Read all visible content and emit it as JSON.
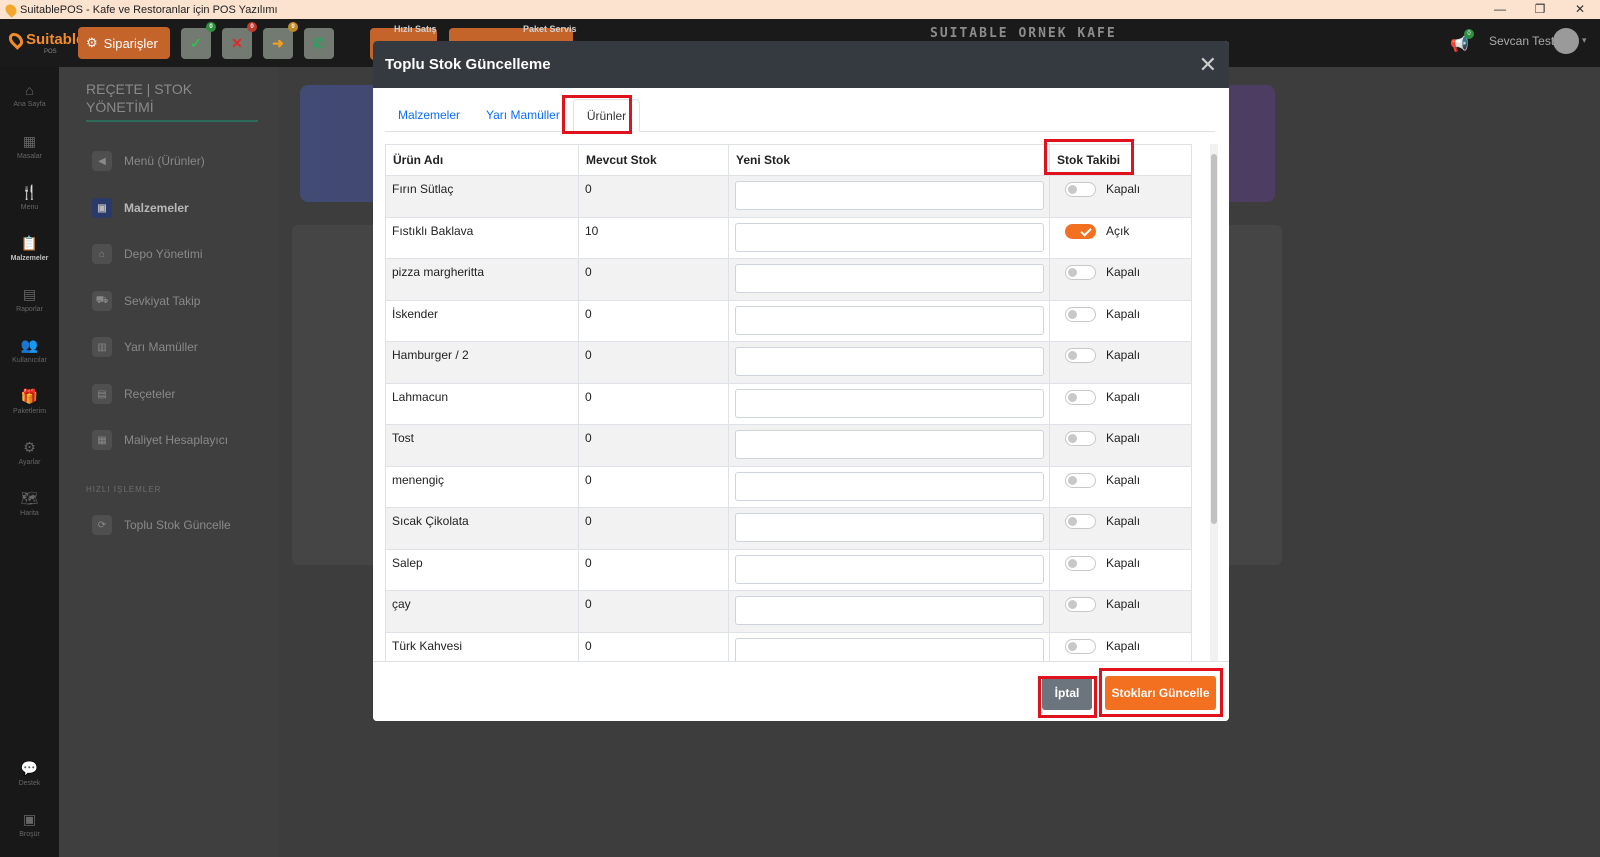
{
  "window": {
    "title": "SuitablePOS - Kafe ve Restoranlar için POS Yazılımı",
    "controls": [
      "—",
      "❐",
      "✕"
    ]
  },
  "header": {
    "logo": "Suitable",
    "logo_sub": "POS",
    "orders_label": "Siparişler",
    "badges": {
      "approved": "0",
      "rejected": "0",
      "forwarded": "0"
    },
    "quick_sale_label": "Hızlı Satış",
    "package_service_label": "Paket Servis",
    "cafe_name": "SUITABLE ORNEK KAFE",
    "notification_count": "0",
    "user_name": "Sevcan Test"
  },
  "sidebar": {
    "items": [
      {
        "label": "Ana Sayfa",
        "icon": "home-icon"
      },
      {
        "label": "Masalar",
        "icon": "table-icon"
      },
      {
        "label": "Menu",
        "icon": "utensils-icon"
      },
      {
        "label": "Malzemeler",
        "icon": "clipboard-icon"
      },
      {
        "label": "Raporlar",
        "icon": "report-icon"
      },
      {
        "label": "Kullanıcılar",
        "icon": "users-icon"
      },
      {
        "label": "Paketlerim",
        "icon": "gift-icon"
      },
      {
        "label": "Ayarlar",
        "icon": "gear-icon"
      },
      {
        "label": "Harita",
        "icon": "map-icon"
      },
      {
        "label": "Destek",
        "icon": "chat-icon"
      },
      {
        "label": "Broşür",
        "icon": "brochure-icon"
      }
    ]
  },
  "left_panel": {
    "title_line1": "REÇETE | STOK",
    "title_line2": "YÖNETİMİ",
    "menu": [
      "Menü (Ürünler)",
      "Malzemeler",
      "Depo Yönetimi",
      "Sevkiyat Takip",
      "Yarı Mamüller",
      "Reçeteler",
      "Maliyet Hesaplayıcı"
    ],
    "quick_section": "HIZLI İŞLEMLER",
    "quick_action": "Toplu Stok Güncelle"
  },
  "modal": {
    "title": "Toplu Stok Güncelleme",
    "close": "✕",
    "tabs": [
      "Malzemeler",
      "Yarı Mamüller",
      "Ürünler"
    ],
    "active_tab": "Ürünler",
    "columns": [
      "Ürün Adı",
      "Mevcut Stok",
      "Yeni Stok",
      "Stok Takibi"
    ],
    "rows": [
      {
        "name": "Fırın Sütlaç",
        "stock": "0",
        "tracking": "Kapalı",
        "on": false
      },
      {
        "name": "Fıstıklı Baklava",
        "stock": "10",
        "tracking": "Açık",
        "on": true
      },
      {
        "name": "pizza margheritta",
        "stock": "0",
        "tracking": "Kapalı",
        "on": false
      },
      {
        "name": "İskender",
        "stock": "0",
        "tracking": "Kapalı",
        "on": false
      },
      {
        "name": "Hamburger / 2",
        "stock": "0",
        "tracking": "Kapalı",
        "on": false
      },
      {
        "name": "Lahmacun",
        "stock": "0",
        "tracking": "Kapalı",
        "on": false
      },
      {
        "name": "Tost",
        "stock": "0",
        "tracking": "Kapalı",
        "on": false
      },
      {
        "name": "menengiç",
        "stock": "0",
        "tracking": "Kapalı",
        "on": false
      },
      {
        "name": "Sıcak Çikolata",
        "stock": "0",
        "tracking": "Kapalı",
        "on": false
      },
      {
        "name": "Salep",
        "stock": "0",
        "tracking": "Kapalı",
        "on": false
      },
      {
        "name": "çay",
        "stock": "0",
        "tracking": "Kapalı",
        "on": false
      },
      {
        "name": "Türk Kahvesi",
        "stock": "0",
        "tracking": "Kapalı",
        "on": false
      }
    ],
    "cancel_label": "İptal",
    "update_label": "Stokları Güncelle"
  },
  "colors": {
    "accent": "#f37021",
    "header_dark": "#343a40",
    "highlight": "#e0121d",
    "link": "#0d6efd"
  }
}
